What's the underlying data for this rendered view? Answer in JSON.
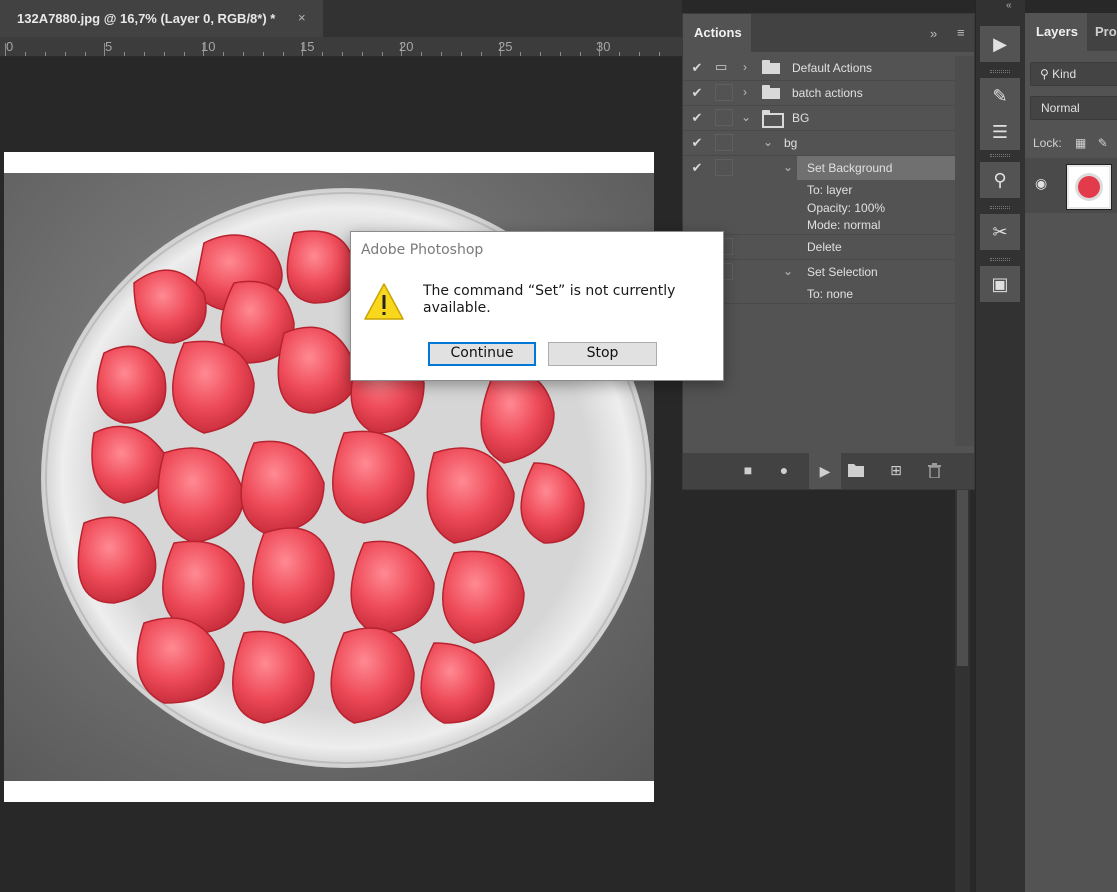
{
  "document": {
    "tab_title": "132A7880.jpg @ 16,7% (Layer 0, RGB/8*) *",
    "close_glyph": "×",
    "ruler_labels": [
      "0",
      "5",
      "10",
      "15",
      "20",
      "25",
      "30"
    ]
  },
  "actions_panel": {
    "tab_label": "Actions",
    "expand_glyph": "»",
    "menu_glyph": "≡",
    "rows": [
      {
        "label": "Default Actions",
        "checked": true
      },
      {
        "label": "batch actions",
        "checked": true
      },
      {
        "label": "BG",
        "checked": true
      },
      {
        "label": "bg",
        "checked": true
      },
      {
        "label": "Set Background",
        "checked": true,
        "selected": true
      },
      {
        "label": "To: layer"
      },
      {
        "label": "Opacity: 100%"
      },
      {
        "label": "Mode: normal"
      },
      {
        "label": "Delete"
      },
      {
        "label": "Set Selection"
      },
      {
        "label": "To: none"
      }
    ],
    "check_glyph": "✔",
    "footer_icons": [
      "stop-icon",
      "record-icon",
      "play-icon",
      "folder-icon",
      "new-action-icon",
      "trash-icon"
    ]
  },
  "dialog": {
    "title": "Adobe Photoshop",
    "message": "The command “Set” is not currently available.",
    "continue_label": "Continue",
    "stop_label": "Stop"
  },
  "layers_panel": {
    "tab_layers": "Layers",
    "tab_properties": "Pro",
    "kind_label": "Kind",
    "blend_mode": "Normal",
    "lock_label": "Lock:"
  },
  "tools": [
    "play-icon",
    "brush-preset-icon",
    "adjustments-icon",
    "clone-source-icon",
    "tools-icon",
    "navigator-icon"
  ],
  "colors": {
    "accent": "#0078d7",
    "candy": "#e23b4b",
    "panel": "#535353",
    "dark": "#282828"
  }
}
